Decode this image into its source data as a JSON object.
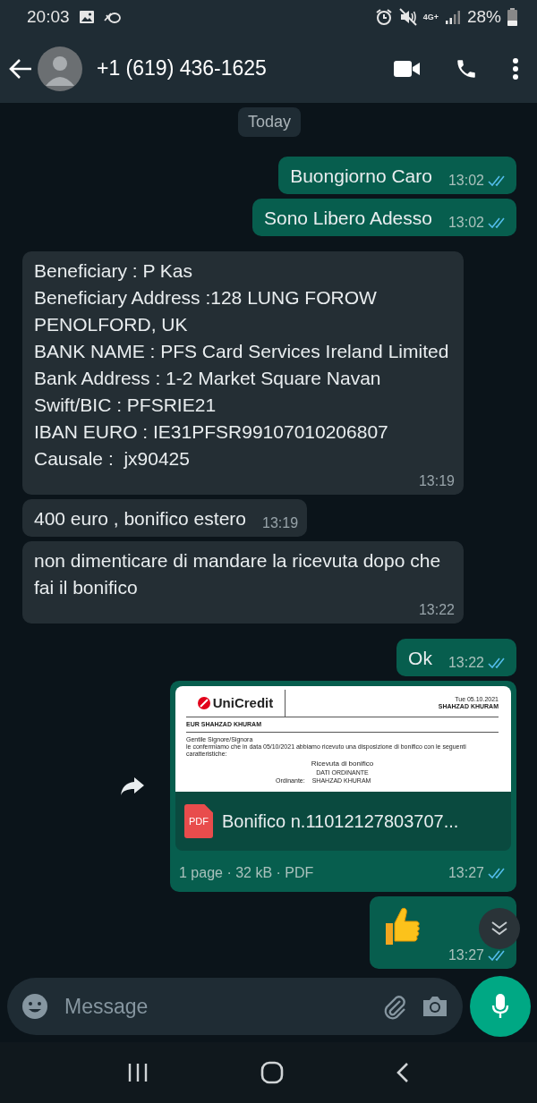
{
  "status_bar": {
    "time": "20:03",
    "network": "4G+",
    "battery": "28%"
  },
  "header": {
    "contact": "+1 (619) 436-1625"
  },
  "chat": {
    "date_chip": "Today",
    "messages": [
      {
        "kind": "text",
        "outgoing": true,
        "text": "Buongiorno Caro",
        "time": "13:02",
        "read": true
      },
      {
        "kind": "text",
        "outgoing": true,
        "text": "Sono Libero Adesso",
        "time": "13:02",
        "read": true
      },
      {
        "kind": "text",
        "outgoing": false,
        "text": "Beneficiary : P Kas\nBeneficiary Address :128 LUNG FOROW PENOLFORD, UK\nBANK NAME : PFS Card Services Ireland Limited\nBank Address : 1-2 Market Square Navan\nSwift/BIC : PFSRIE21\nIBAN EURO : IE31PFSR99107010206807\nCausale :  jx90425",
        "time": "13:19"
      },
      {
        "kind": "text",
        "outgoing": false,
        "text": "400 euro , bonifico estero",
        "time": "13:19"
      },
      {
        "kind": "text",
        "outgoing": false,
        "text": "non dimenticare di mandare la ricevuta dopo che fai il bonifico",
        "time": "13:22"
      },
      {
        "kind": "text",
        "outgoing": true,
        "text": "Ok",
        "time": "13:22",
        "read": true
      },
      {
        "kind": "document",
        "outgoing": true,
        "file_type": "PDF",
        "file_name": "Bonifico n.11012127803707...",
        "meta": "1 page · 32 kB · PDF",
        "time": "13:27",
        "read": true,
        "preview": {
          "logo": "UniCredit",
          "date": "Tue 05.10.2021",
          "name": "SHAHZAD KHURAM",
          "account": "EUR SHAHZAD KHURAM",
          "greeting": "Gentile Signore/Signora",
          "body": "le confermiamo che in data 05/10/2021 abbiamo ricevuto una disposizione di bonifico con le seguenti caratteristiche:",
          "heading": "Ricevuta di bonifico",
          "section": "DATI ORDINANTE",
          "field_label": "Ordinante:",
          "field_value": "SHAHZAD KHURAM"
        }
      },
      {
        "kind": "emoji",
        "outgoing": true,
        "time": "13:27",
        "read": true
      }
    ]
  },
  "composer": {
    "placeholder": "Message"
  }
}
